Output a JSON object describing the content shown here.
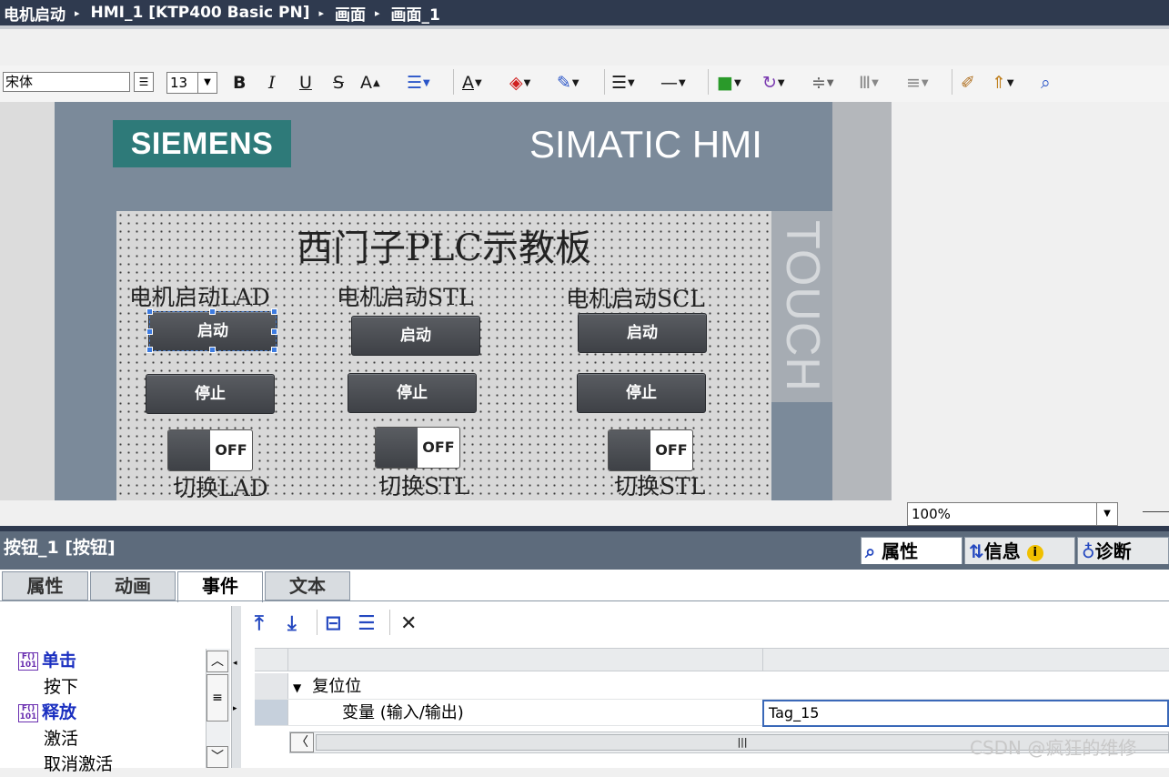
{
  "breadcrumb": {
    "items": [
      "电机启动",
      "HMI_1 [KTP400 Basic PN]",
      "画面",
      "画面_1"
    ],
    "separator": "▸"
  },
  "toolbar": {
    "font_name": "宋体",
    "font_size": "13",
    "bold": "B",
    "italic": "I",
    "underline": "U",
    "strike": "S",
    "grow": "A"
  },
  "device": {
    "brand_logo": "SIEMENS",
    "product": "SIMATIC HMI",
    "side_text": "TOUCH"
  },
  "hmi_screen": {
    "title": "西门子PLC示教板",
    "columns": [
      {
        "label": "电机启动LAD",
        "start": "启动",
        "stop": "停止",
        "switch": "OFF",
        "switch_label": "切换LAD"
      },
      {
        "label": "电机启动STL",
        "start": "启动",
        "stop": "停止",
        "switch": "OFF",
        "switch_label": "切换STL"
      },
      {
        "label": "电机启动SCL",
        "start": "启动",
        "stop": "停止",
        "switch": "OFF",
        "switch_label": "切换STL"
      }
    ]
  },
  "zoom": {
    "value": "100%"
  },
  "inspector": {
    "object_title": "按钮_1 [按钮]",
    "right_tabs": [
      "属性",
      "信息",
      "诊断"
    ],
    "left_tabs": [
      "属性",
      "动画",
      "事件",
      "文本"
    ],
    "active_left_tab": "事件",
    "events": [
      {
        "label": "单击",
        "group": true
      },
      {
        "label": "按下",
        "group": false
      },
      {
        "label": "释放",
        "group": true
      },
      {
        "label": "激活",
        "group": false
      },
      {
        "label": "取消激活",
        "group": false
      }
    ],
    "function_list": {
      "function_name": "复位位",
      "param_label": "变量 (输入/输出)",
      "param_value": "Tag_15"
    }
  },
  "watermark": "CSDN @疯狂的维修"
}
